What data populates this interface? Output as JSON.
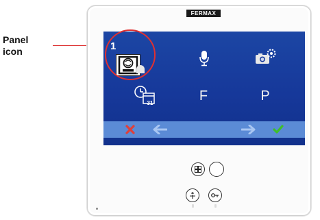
{
  "callout": {
    "label": "Panel\nicon",
    "line1": "Panel",
    "line2": "icon"
  },
  "device": {
    "brand": "FERMAX"
  },
  "screen": {
    "step_number": "1",
    "row2": {
      "letter_f": "F",
      "letter_p": "P"
    },
    "calendar_day": "31"
  },
  "icons": {
    "panel": "panel-icon",
    "microphone": "microphone-icon",
    "camera_settings": "camera-settings-icon",
    "clock_calendar": "clock-calendar-icon",
    "cancel": "cancel-x-icon",
    "back": "arrow-left-icon",
    "forward": "arrow-right-icon",
    "confirm": "check-icon"
  },
  "colors": {
    "screen_blue": "#16389a",
    "bar_blue": "#5b8bd6",
    "highlight_red": "#e03030",
    "cancel_red": "#e0403a",
    "confirm_green": "#3fbf2a"
  }
}
